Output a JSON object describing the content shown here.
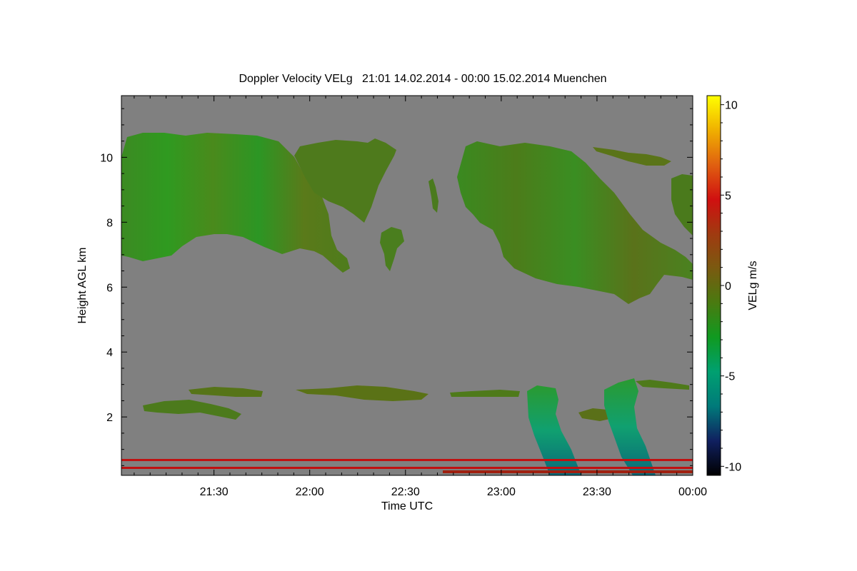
{
  "chart_data": {
    "type": "heatmap",
    "title": "Doppler Velocity VELg   21:01 14.02.2014 - 00:00 15.02.2014 Muenchen",
    "xlabel": "Time UTC",
    "ylabel": "Height AGL km",
    "x_range": [
      "21:01",
      "00:00"
    ],
    "x_ticks": [
      "21:30",
      "22:00",
      "22:30",
      "23:00",
      "23:30",
      "00:00"
    ],
    "y_range": [
      0.2,
      11.9
    ],
    "y_ticks": [
      2,
      4,
      6,
      8,
      10
    ],
    "y_tick_labels": [
      "2",
      "4",
      "6",
      "8",
      "10"
    ],
    "background_color": "#808080",
    "colorbar": {
      "label": "VELg m/s",
      "range": [
        -10.5,
        10.5
      ],
      "ticks": [
        10,
        5,
        0,
        -5,
        -10
      ],
      "tick_labels": [
        "10",
        "5",
        "0",
        "-5",
        "-10"
      ],
      "colors": [
        "#000000",
        "#102060",
        "#007a7a",
        "#00a070",
        "#109a20",
        "#4a7a10",
        "#7a5a10",
        "#a03a10",
        "#d01010",
        "#e06010",
        "#f0b000",
        "#ffff00"
      ]
    },
    "regions": [
      {
        "name": "upper-cloud-west",
        "time_start": "21:01",
        "time_end": "22:22",
        "height_min": 6.3,
        "height_max": 10.9,
        "velocity_mean": -0.5
      },
      {
        "name": "upper-cloud-fragment",
        "time_start": "22:21",
        "time_end": "22:25",
        "height_min": 6.5,
        "height_max": 8.1,
        "velocity_mean": -0.5
      },
      {
        "name": "upper-cloud-east",
        "time_start": "22:48",
        "time_end": "00:00",
        "height_min": 5.6,
        "height_max": 10.8,
        "velocity_mean": -0.3
      },
      {
        "name": "mid-layer-1",
        "time_start": "21:08",
        "time_end": "21:45",
        "height_min": 1.9,
        "height_max": 2.9,
        "velocity_mean": 0.3
      },
      {
        "name": "mid-layer-2",
        "time_start": "21:55",
        "time_end": "23:10",
        "height_min": 2.3,
        "height_max": 2.9,
        "velocity_mean": 0.5
      },
      {
        "name": "precip-streak-1",
        "time_start": "23:08",
        "time_end": "23:26",
        "height_min": 0.2,
        "height_max": 3.0,
        "velocity_mean": -3.5
      },
      {
        "name": "precip-streak-2",
        "time_start": "23:25",
        "time_end": "23:47",
        "height_min": 0.2,
        "height_max": 3.3,
        "velocity_mean": -3.0
      },
      {
        "name": "near-surface-band",
        "time_start": "21:01",
        "time_end": "00:00",
        "height_min": 0.2,
        "height_max": 0.6,
        "velocity_mean": 2.0
      }
    ]
  }
}
